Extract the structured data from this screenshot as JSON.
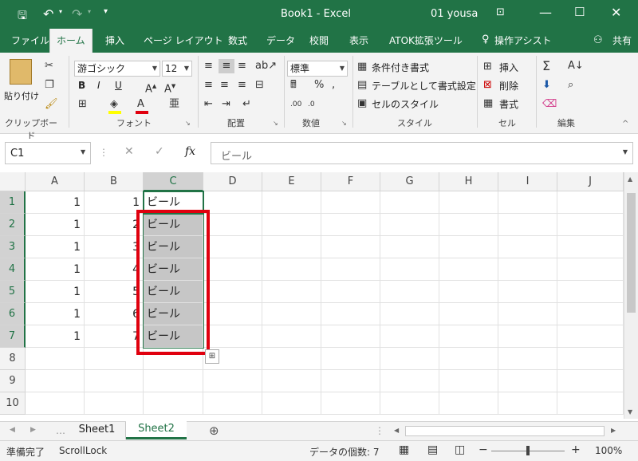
{
  "titlebar": {
    "title": "Book1  -  Excel",
    "user": "01 yousa",
    "save_icon": "save-icon",
    "undo_icon": "undo-icon",
    "redo_icon": "redo-icon"
  },
  "tabs": [
    {
      "label": "ファイル"
    },
    {
      "label": "ホーム"
    },
    {
      "label": "挿入"
    },
    {
      "label": "ページ レイアウト"
    },
    {
      "label": "数式"
    },
    {
      "label": "データ"
    },
    {
      "label": "校閲"
    },
    {
      "label": "表示"
    },
    {
      "label": "ATOK拡張ツール"
    },
    {
      "label": "操作アシスト"
    },
    {
      "label": "共有"
    }
  ],
  "ribbon": {
    "clipboard": {
      "paste": "貼り付け",
      "label": "クリップボード"
    },
    "font": {
      "name": "游ゴシック",
      "size": "12",
      "bold": "B",
      "italic": "I",
      "underline": "U",
      "label": "フォント"
    },
    "alignment": {
      "label": "配置"
    },
    "number": {
      "format": "標準",
      "label": "数値"
    },
    "styles": {
      "conditional": "条件付き書式",
      "table": "テーブルとして書式設定",
      "cell": "セルのスタイル",
      "label": "スタイル"
    },
    "cells": {
      "insert": "挿入",
      "delete": "削除",
      "format": "書式",
      "label": "セル"
    },
    "editing": {
      "label": "編集"
    }
  },
  "formula_bar": {
    "namebox": "C1",
    "fx": "fx",
    "content": "ビール"
  },
  "columns": [
    "A",
    "B",
    "C",
    "D",
    "E",
    "F",
    "G",
    "H",
    "I",
    "J"
  ],
  "rows": [
    {
      "num": "1",
      "a": "1",
      "b": "1",
      "c": "ビール"
    },
    {
      "num": "2",
      "a": "1",
      "b": "2",
      "c": "ビール"
    },
    {
      "num": "3",
      "a": "1",
      "b": "3",
      "c": "ビール"
    },
    {
      "num": "4",
      "a": "1",
      "b": "4",
      "c": "ビール"
    },
    {
      "num": "5",
      "a": "1",
      "b": "5",
      "c": "ビール"
    },
    {
      "num": "6",
      "a": "1",
      "b": "6",
      "c": "ビール"
    },
    {
      "num": "7",
      "a": "1",
      "b": "7",
      "c": "ビール"
    },
    {
      "num": "8",
      "a": "",
      "b": "",
      "c": ""
    },
    {
      "num": "9",
      "a": "",
      "b": "",
      "c": ""
    },
    {
      "num": "10",
      "a": "",
      "b": "",
      "c": ""
    }
  ],
  "sheets": [
    {
      "label": "Sheet1"
    },
    {
      "label": "Sheet2"
    }
  ],
  "status": {
    "ready": "準備完了",
    "scroll_lock": "ScrollLock",
    "count": "データの個数: 7",
    "zoom": "100%"
  },
  "colors": {
    "excel_green": "#217346",
    "selection_red": "#e0000e",
    "selection_fill": "#c6c6c6"
  }
}
